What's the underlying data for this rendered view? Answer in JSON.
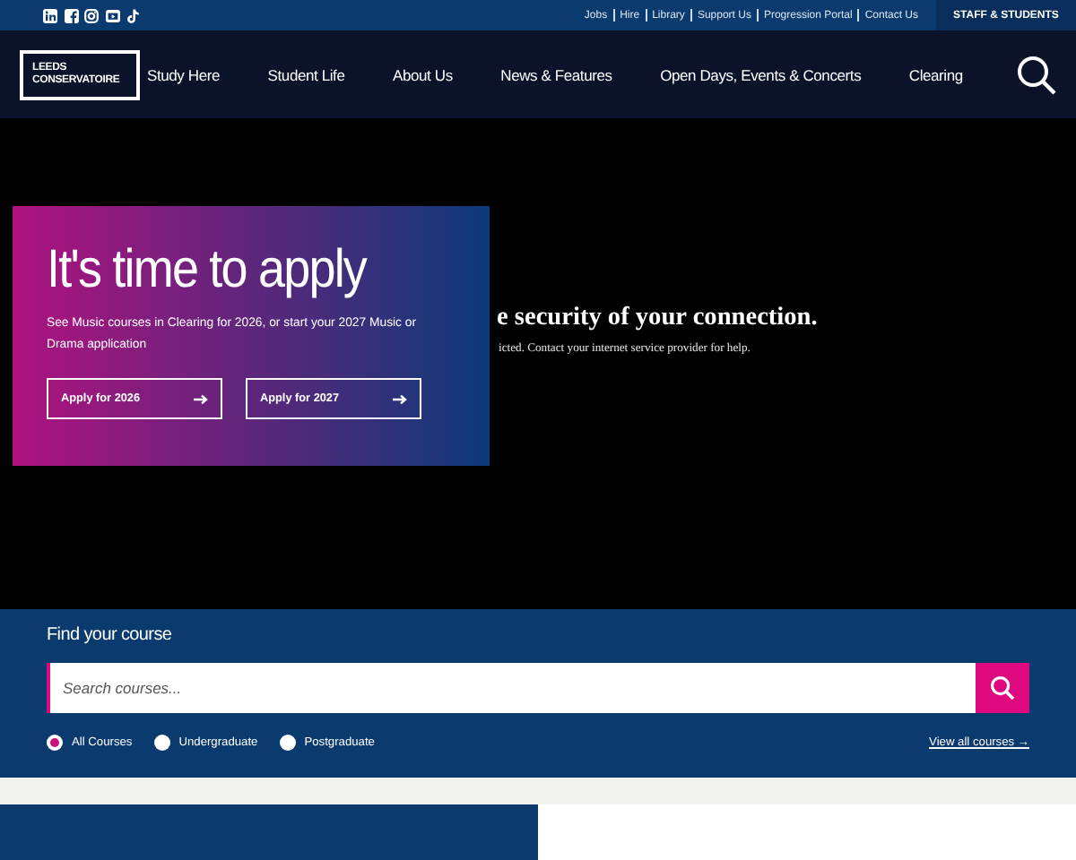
{
  "top_bar": {
    "social": [
      {
        "kind": "linkedin"
      },
      {
        "kind": "facebook"
      },
      {
        "kind": "instagram"
      },
      {
        "kind": "youtube"
      },
      {
        "kind": "tiktok"
      }
    ],
    "links": [
      "Jobs",
      "Hire",
      "Library",
      "Support Us",
      "Progression Portal",
      "Contact Us"
    ],
    "staff_button": "STAFF & STUDENTS"
  },
  "nav": {
    "logo": [
      "LEEDS",
      "CONSERVATOIRE"
    ],
    "items": [
      "Study Here",
      "Student Life",
      "About Us",
      "News & Features",
      "Open Days, Events & Concerts",
      "Clearing"
    ]
  },
  "hero": {
    "error_title": "e security of your connection.",
    "error_text": "icted. Contact your internet service provider for help.",
    "card": {
      "title": "It's time to apply",
      "text": "See Music courses in Clearing for 2026, or start your 2027 Music or Drama application",
      "buttons": [
        "Apply for 2026",
        "Apply for 2027"
      ]
    }
  },
  "course_search": {
    "heading": "Find your course",
    "placeholder": "Search courses...",
    "filters": [
      {
        "label": "All Courses",
        "selected": true
      },
      {
        "label": "Undergraduate",
        "selected": false
      },
      {
        "label": "Postgraduate",
        "selected": false
      }
    ],
    "view_all": "View all courses →"
  }
}
